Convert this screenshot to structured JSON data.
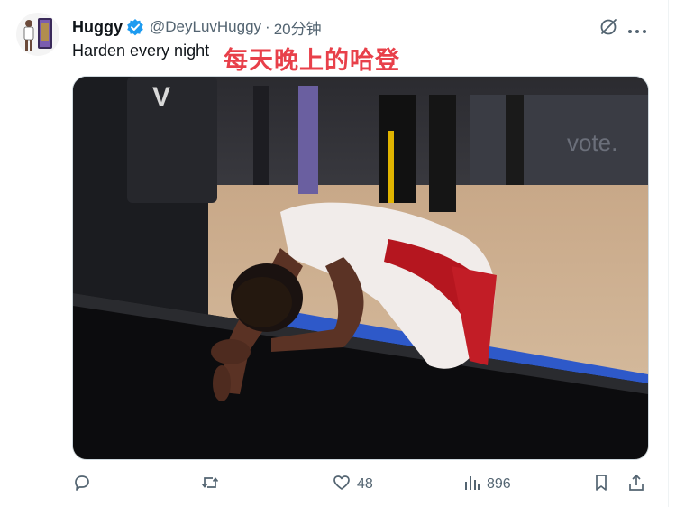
{
  "author": {
    "display_name": "Huggy",
    "handle": "@DeyLuvHuggy",
    "separator": "·",
    "timestamp": "20分钟",
    "verified": true
  },
  "tweet": {
    "text": "Harden every night",
    "annotation": "每天晚上的哈登"
  },
  "media": {
    "alt": "Basketball player in white and red jersey bent over courtside barrier",
    "scoreboard_text": "vote.",
    "panel_letter": "V"
  },
  "actions": {
    "reply_icon": "reply-icon",
    "retweet_icon": "retweet-icon",
    "like_count": "48",
    "views_count": "896",
    "bookmark_icon": "bookmark-icon",
    "share_icon": "share-icon"
  },
  "colors": {
    "accent_blue": "#1d9bf0",
    "annotation_red": "#e8404a",
    "muted_text": "#536471"
  }
}
